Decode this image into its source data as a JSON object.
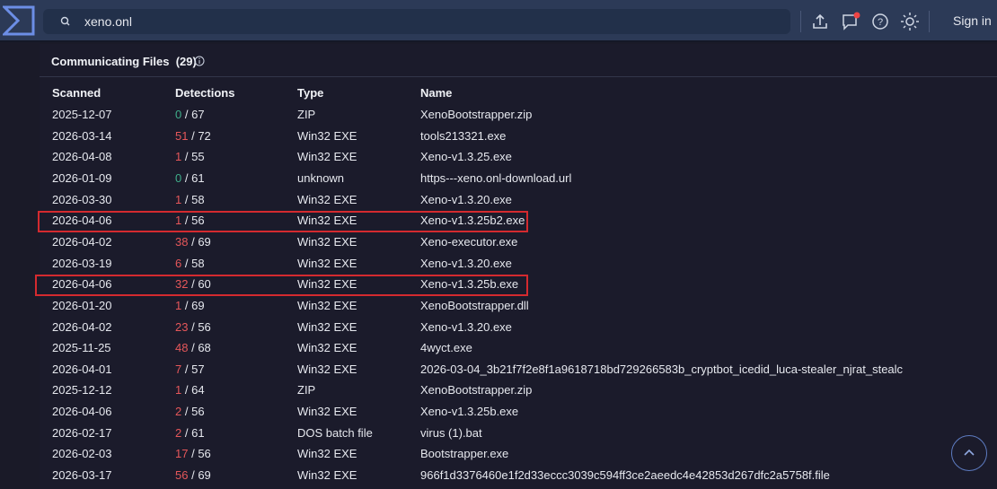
{
  "header": {
    "search_value": "xeno.onl",
    "sign_in": "Sign in",
    "icons": [
      "upload-icon",
      "notifications-icon",
      "help-icon",
      "theme-icon"
    ],
    "notification_dot_color": "#ef4444"
  },
  "panel": {
    "title": "Communicating Files",
    "count": "(29)"
  },
  "columns": [
    "Scanned",
    "Detections",
    "Type",
    "Name"
  ],
  "rows": [
    {
      "scanned": "2025-12-07",
      "det": "0",
      "total": "/ 67",
      "type": "ZIP",
      "name": "XenoBootstrapper.zip"
    },
    {
      "scanned": "2026-03-14",
      "det": "51",
      "total": "/ 72",
      "type": "Win32 EXE",
      "name": "tools213321.exe"
    },
    {
      "scanned": "2026-04-08",
      "det": "1",
      "total": "/ 55",
      "type": "Win32 EXE",
      "name": "Xeno-v1.3.25.exe"
    },
    {
      "scanned": "2026-01-09",
      "det": "0",
      "total": "/ 61",
      "type": "unknown",
      "name": "https---xeno.onl-download.url"
    },
    {
      "scanned": "2026-03-30",
      "det": "1",
      "total": "/ 58",
      "type": "Win32 EXE",
      "name": "Xeno-v1.3.20.exe"
    },
    {
      "scanned": "2026-04-06",
      "det": "1",
      "total": "/ 56",
      "type": "Win32 EXE",
      "name": "Xeno-v1.3.25b2.exe",
      "highlighted": true
    },
    {
      "scanned": "2026-04-02",
      "det": "38",
      "total": "/ 69",
      "type": "Win32 EXE",
      "name": "Xeno-executor.exe"
    },
    {
      "scanned": "2026-03-19",
      "det": "6",
      "total": "/ 58",
      "type": "Win32 EXE",
      "name": "Xeno-v1.3.20.exe"
    },
    {
      "scanned": "2026-04-06",
      "det": "32",
      "total": "/ 60",
      "type": "Win32 EXE",
      "name": "Xeno-v1.3.25b.exe",
      "highlighted": true
    },
    {
      "scanned": "2026-01-20",
      "det": "1",
      "total": "/ 69",
      "type": "Win32 EXE",
      "name": "XenoBootstrapper.dll"
    },
    {
      "scanned": "2026-04-02",
      "det": "23",
      "total": "/ 56",
      "type": "Win32 EXE",
      "name": "Xeno-v1.3.20.exe"
    },
    {
      "scanned": "2025-11-25",
      "det": "48",
      "total": "/ 68",
      "type": "Win32 EXE",
      "name": "4wyct.exe"
    },
    {
      "scanned": "2026-04-01",
      "det": "7",
      "total": "/ 57",
      "type": "Win32 EXE",
      "name": "2026-03-04_3b21f7f2e8f1a9618718bd729266583b_cryptbot_icedid_luca-stealer_njrat_stealc"
    },
    {
      "scanned": "2025-12-12",
      "det": "1",
      "total": "/ 64",
      "type": "ZIP",
      "name": "XenoBootstrapper.zip"
    },
    {
      "scanned": "2026-04-06",
      "det": "2",
      "total": "/ 56",
      "type": "Win32 EXE",
      "name": "Xeno-v1.3.25b.exe"
    },
    {
      "scanned": "2026-02-17",
      "det": "2",
      "total": "/ 61",
      "type": "DOS batch file",
      "name": "virus (1).bat"
    },
    {
      "scanned": "2026-02-03",
      "det": "17",
      "total": "/ 56",
      "type": "Win32 EXE",
      "name": "Bootstrapper.exe"
    },
    {
      "scanned": "2026-03-17",
      "det": "56",
      "total": "/ 69",
      "type": "Win32 EXE",
      "name": "966f1d3376460e1f2d33eccc3039c594ff3ce2aeedc4e42853d267dfc2a5758f.file"
    }
  ]
}
